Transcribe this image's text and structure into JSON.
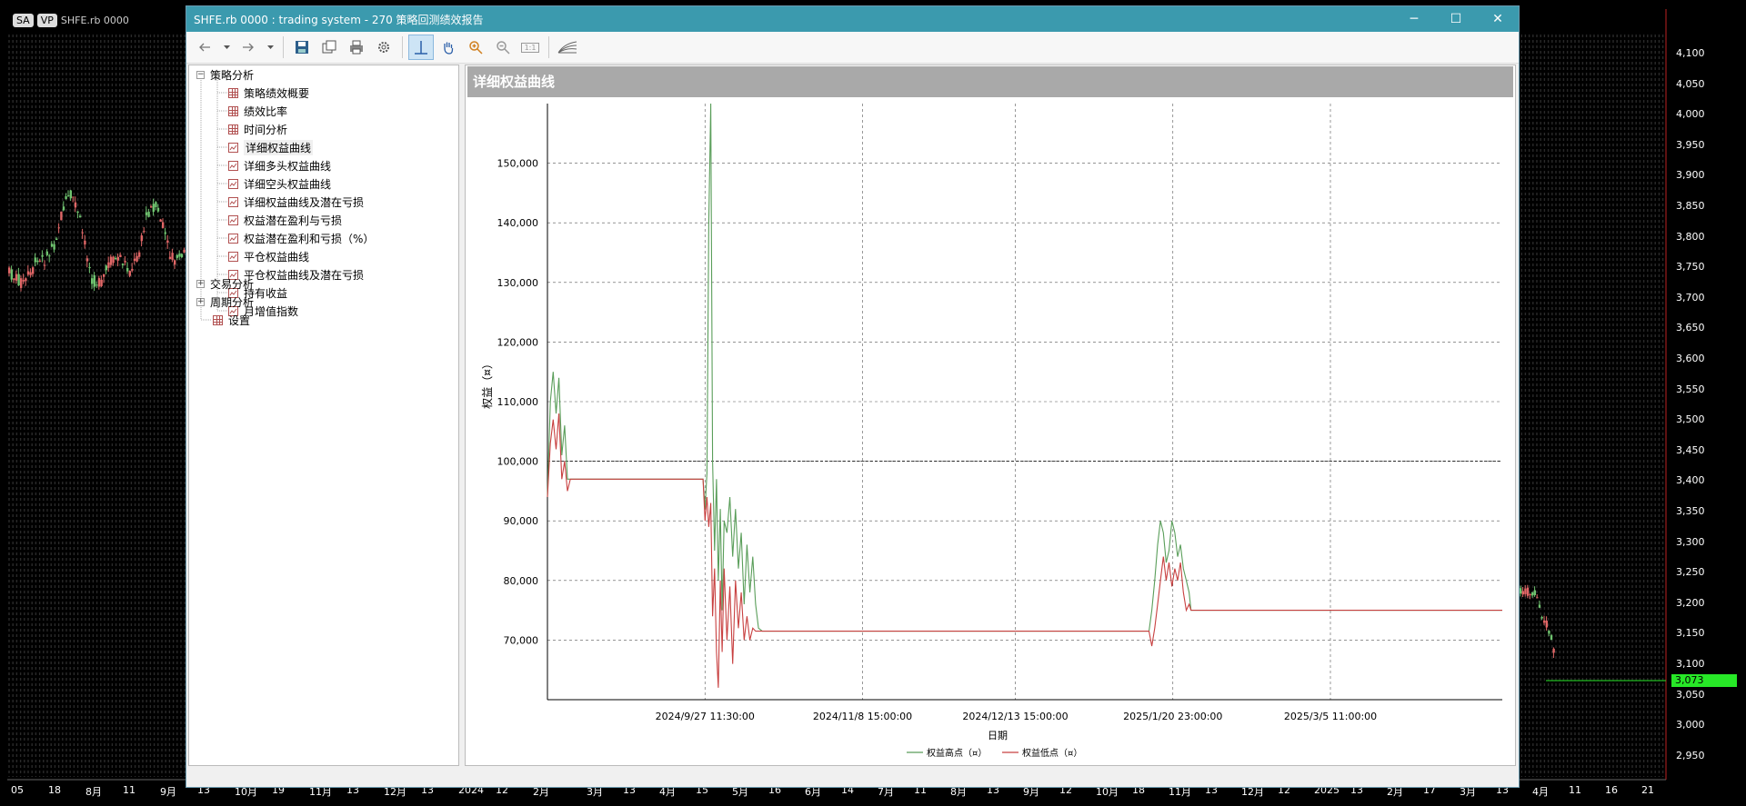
{
  "background": {
    "top_tags": [
      "SA",
      "VP"
    ],
    "symbol_label": "SHFE.rb 0000",
    "price_axis": [
      "4,100",
      "4,050",
      "4,000",
      "3,950",
      "3,900",
      "3,850",
      "3,800",
      "3,750",
      "3,700",
      "3,650",
      "3,600",
      "3,550",
      "3,500",
      "3,450",
      "3,400",
      "3,350",
      "3,300",
      "3,250",
      "3,200",
      "3,150",
      "3,100",
      "3,050",
      "3,000",
      "2,950"
    ],
    "current_price": "3,073",
    "time_axis_left": [
      "05",
      "18",
      "8月",
      "11",
      "9月",
      "13",
      "10月",
      "19",
      "11月",
      "13",
      "12月",
      "13",
      "2024",
      "12",
      "2月"
    ],
    "time_axis_right": [
      "3月",
      "13",
      "4月",
      "15",
      "5月",
      "16",
      "6月",
      "14",
      "7月",
      "11",
      "8月",
      "13",
      "9月",
      "12",
      "10月",
      "18",
      "11月",
      "13",
      "12月",
      "12",
      "2025",
      "13",
      "2月",
      "17",
      "3月",
      "13",
      "4月",
      "11",
      "16",
      "21"
    ],
    "colors": {
      "up": "#e06666",
      "down": "#6fc36f",
      "current_price": "#27e827"
    }
  },
  "window": {
    "title": "SHFE.rb 0000 : trading system - 270 策略回测绩效报告",
    "controls": {
      "minimize": "─",
      "maximize": "☐",
      "close": "✕"
    },
    "accent": "#3b9aae"
  },
  "toolbar": {
    "icons": [
      "back-arrow-icon",
      "dropdown-icon",
      "forward-arrow-icon",
      "dropdown-icon",
      "save-icon",
      "copy-icon",
      "print-icon",
      "settings-gear-icon",
      "crosshair-icon",
      "pan-hand-icon",
      "zoom-in-icon",
      "zoom-out-icon",
      "actual-size-icon",
      "fan-chart-icon"
    ],
    "actual_size_label": "1:1"
  },
  "tree": {
    "root": "策略分析",
    "items": [
      {
        "label": "策略绩效概要",
        "icon": "table-icon"
      },
      {
        "label": "绩效比率",
        "icon": "table-icon"
      },
      {
        "label": "时间分析",
        "icon": "table-icon"
      },
      {
        "label": "详细权益曲线",
        "icon": "chart-icon",
        "selected": true
      },
      {
        "label": "详细多头权益曲线",
        "icon": "chart-icon"
      },
      {
        "label": "详细空头权益曲线",
        "icon": "chart-icon"
      },
      {
        "label": "详细权益曲线及潜在亏损",
        "icon": "chart-icon"
      },
      {
        "label": "权益潜在盈利与亏损",
        "icon": "chart-icon"
      },
      {
        "label": "权益潜在盈利和亏损（%）",
        "icon": "chart-icon"
      },
      {
        "label": "平仓权益曲线",
        "icon": "chart-icon"
      },
      {
        "label": "平仓权益曲线及潜在亏损",
        "icon": "chart-icon"
      },
      {
        "label": "持有收益",
        "icon": "chart-icon"
      },
      {
        "label": "月增值指数",
        "icon": "chart-icon"
      }
    ],
    "groups": [
      "交易分析",
      "周期分析"
    ],
    "settings": "设置"
  },
  "report": {
    "header": "详细权益曲线"
  },
  "chart_data": {
    "type": "line",
    "xlabel": "日期",
    "ylabel": "权益（¤）",
    "ylim": [
      60000,
      160000
    ],
    "yticks": [
      70000,
      80000,
      90000,
      100000,
      110000,
      120000,
      130000,
      140000,
      150000
    ],
    "ytick_labels": [
      "70,000",
      "80,000",
      "90,000",
      "100,000",
      "110,000",
      "120,000",
      "130,000",
      "140,000",
      "150,000"
    ],
    "xlim": [
      0,
      100
    ],
    "xticks": [
      16.5,
      33,
      49,
      65.5,
      82
    ],
    "xtick_labels": [
      "2024/9/27 11:30:00",
      "2024/11/8 15:00:00",
      "2024/12/13 15:00:00",
      "2025/1/20 23:00:00",
      "2025/3/5 11:00:00"
    ],
    "reference_line": 100000,
    "legend": "bottom-center",
    "series": [
      {
        "name": "权益高点（¤）",
        "color": "#5a9e5a",
        "x": [
          0,
          0.3,
          0.6,
          0.9,
          1.2,
          1.5,
          1.8,
          2.1,
          2.4,
          2.7,
          3.0,
          16.3,
          16.5,
          16.7,
          16.9,
          17.1,
          17.3,
          17.5,
          17.7,
          17.9,
          18.1,
          18.3,
          18.5,
          18.8,
          19.1,
          19.4,
          19.7,
          20.0,
          20.3,
          20.6,
          20.9,
          21.2,
          21.5,
          21.8,
          22.1,
          22.5,
          63.0,
          63.3,
          63.6,
          63.9,
          64.2,
          64.5,
          64.8,
          65.1,
          65.4,
          65.7,
          66.0,
          66.3,
          66.6,
          66.9,
          67.2,
          67.4,
          100
        ],
        "y": [
          94000,
          110000,
          115000,
          108000,
          114000,
          101000,
          106000,
          97000,
          97000,
          97000,
          97000,
          97000,
          92000,
          98000,
          140000,
          160000,
          100000,
          85000,
          97000,
          80000,
          92000,
          75000,
          90000,
          88000,
          94000,
          84000,
          92000,
          82000,
          88000,
          76000,
          86000,
          78000,
          84000,
          76000,
          72000,
          71500,
          71500,
          75000,
          80000,
          86000,
          90000,
          88000,
          83000,
          85000,
          90000,
          88000,
          84000,
          86000,
          82000,
          80000,
          78000,
          75000,
          75000
        ]
      },
      {
        "name": "权益低点（¤）",
        "color": "#c84040",
        "x": [
          0,
          0.3,
          0.6,
          0.9,
          1.2,
          1.5,
          1.8,
          2.1,
          2.4,
          2.7,
          3.0,
          16.3,
          16.5,
          16.7,
          16.9,
          17.1,
          17.3,
          17.5,
          17.7,
          17.9,
          18.1,
          18.3,
          18.5,
          18.8,
          19.1,
          19.4,
          19.7,
          20.0,
          20.3,
          20.6,
          20.9,
          21.2,
          21.5,
          21.8,
          22.1,
          22.5,
          63.0,
          63.3,
          63.6,
          63.9,
          64.2,
          64.5,
          64.8,
          65.1,
          65.4,
          65.7,
          66.0,
          66.3,
          66.6,
          66.9,
          67.2,
          67.4,
          100
        ],
        "y": [
          94000,
          103000,
          107000,
          102000,
          108000,
          97000,
          100000,
          95000,
          97000,
          97000,
          97000,
          97000,
          90000,
          94000,
          89000,
          93000,
          74000,
          82000,
          68000,
          62000,
          80000,
          68000,
          82000,
          70000,
          79000,
          66000,
          80000,
          72000,
          78000,
          70000,
          74000,
          70000,
          72000,
          71500,
          71500,
          71500,
          71500,
          69000,
          72000,
          76000,
          80000,
          84000,
          80000,
          83000,
          79000,
          82000,
          80000,
          83000,
          78000,
          75000,
          76000,
          75000,
          75000
        ]
      }
    ]
  }
}
